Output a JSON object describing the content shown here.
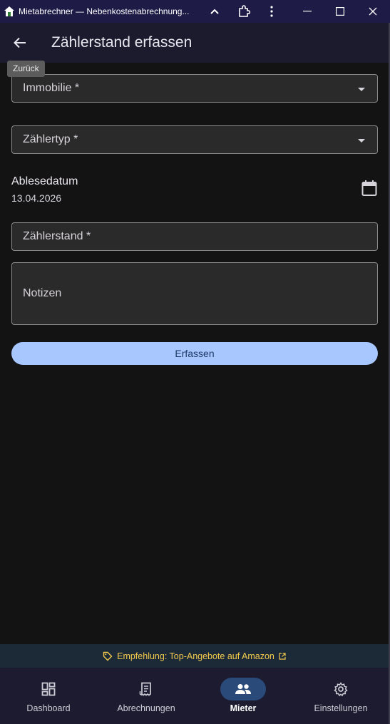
{
  "window": {
    "title": "Mietabrechner — Nebenkostenabrechnung..."
  },
  "appbar": {
    "title": "Zählerstand erfassen",
    "back_tooltip": "Zurück"
  },
  "form": {
    "property_label": "Immobilie *",
    "meter_type_label": "Zählertyp *",
    "reading_date_label": "Ablesedatum",
    "reading_date_value": "13.04.2026",
    "meter_reading_label": "Zählerstand *",
    "notes_label": "Notizen",
    "submit_label": "Erfassen"
  },
  "promo": {
    "text": "Empfehlung: Top-Angebote auf Amazon"
  },
  "nav": {
    "items": [
      {
        "label": "Dashboard",
        "icon": "dashboard-icon"
      },
      {
        "label": "Abrechnungen",
        "icon": "receipt-icon"
      },
      {
        "label": "Mieter",
        "icon": "people-icon",
        "active": true
      },
      {
        "label": "Einstellungen",
        "icon": "gear-icon"
      }
    ]
  },
  "colors": {
    "titlebar": "#1e1b46",
    "appbar": "#1c1b2e",
    "background": "#131313",
    "accent_button": "#a9c7ff",
    "active_nav_pill": "#2a4a7a",
    "promo_text": "#f2c94c"
  }
}
